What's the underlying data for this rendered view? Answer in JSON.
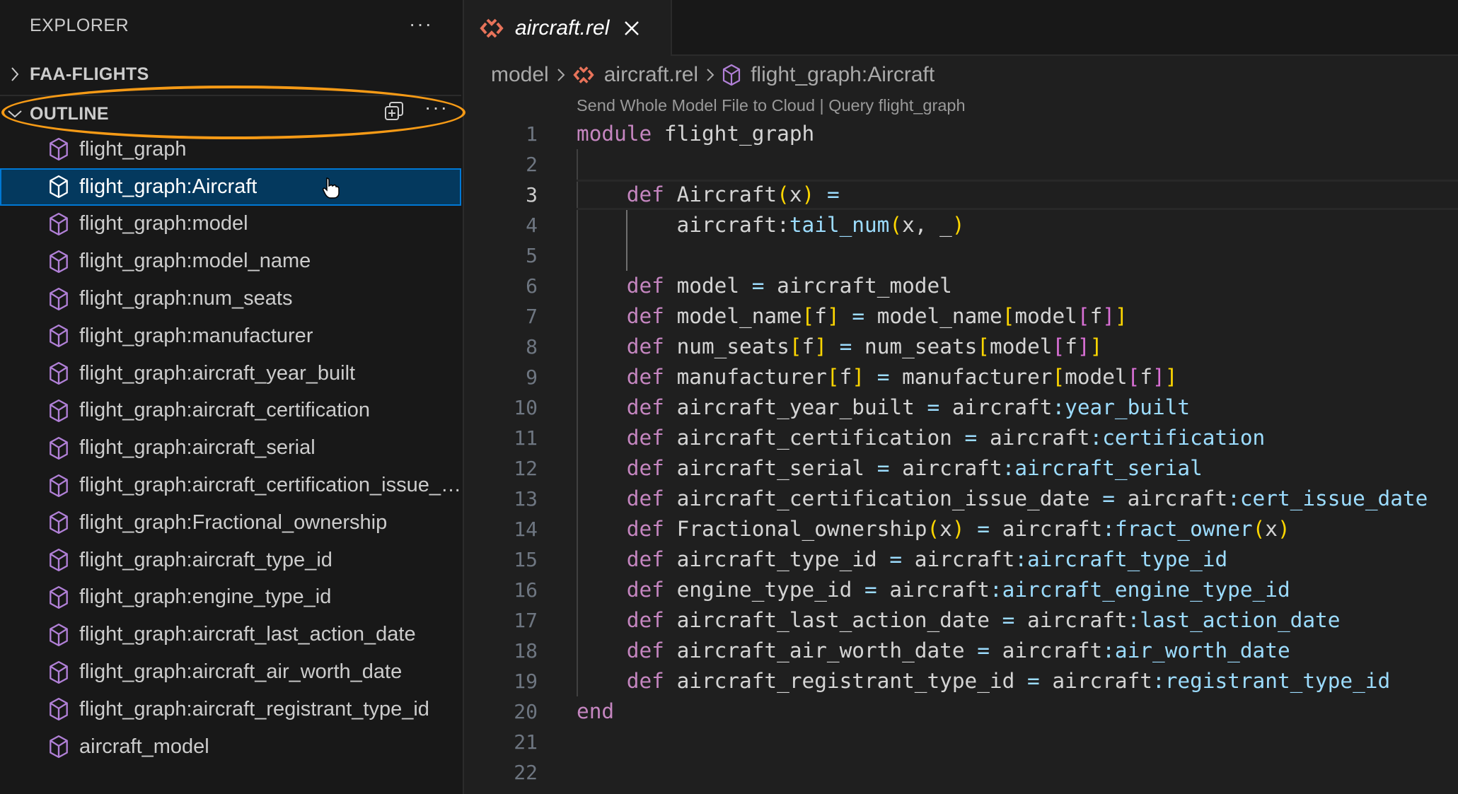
{
  "sidebar": {
    "title": "EXPLORER",
    "more_label": "···",
    "sections": {
      "folder": {
        "label": "FAA-FLIGHTS",
        "expanded": false
      },
      "outline": {
        "label": "OUTLINE",
        "expanded": true,
        "more_label": "···"
      }
    },
    "outline_items": [
      {
        "label": "flight_graph",
        "icon": "module-cube-icon",
        "selected": false
      },
      {
        "label": "flight_graph:Aircraft",
        "icon": "module-cube-icon",
        "selected": true
      },
      {
        "label": "flight_graph:model",
        "icon": "module-cube-icon",
        "selected": false
      },
      {
        "label": "flight_graph:model_name",
        "icon": "module-cube-icon",
        "selected": false
      },
      {
        "label": "flight_graph:num_seats",
        "icon": "module-cube-icon",
        "selected": false
      },
      {
        "label": "flight_graph:manufacturer",
        "icon": "module-cube-icon",
        "selected": false
      },
      {
        "label": "flight_graph:aircraft_year_built",
        "icon": "module-cube-icon",
        "selected": false
      },
      {
        "label": "flight_graph:aircraft_certification",
        "icon": "module-cube-icon",
        "selected": false
      },
      {
        "label": "flight_graph:aircraft_serial",
        "icon": "module-cube-icon",
        "selected": false
      },
      {
        "label": "flight_graph:aircraft_certification_issue_date",
        "icon": "module-cube-icon",
        "selected": false
      },
      {
        "label": "flight_graph:Fractional_ownership",
        "icon": "module-cube-icon",
        "selected": false
      },
      {
        "label": "flight_graph:aircraft_type_id",
        "icon": "module-cube-icon",
        "selected": false
      },
      {
        "label": "flight_graph:engine_type_id",
        "icon": "module-cube-icon",
        "selected": false
      },
      {
        "label": "flight_graph:aircraft_last_action_date",
        "icon": "module-cube-icon",
        "selected": false
      },
      {
        "label": "flight_graph:aircraft_air_worth_date",
        "icon": "module-cube-icon",
        "selected": false
      },
      {
        "label": "flight_graph:aircraft_registrant_type_id",
        "icon": "module-cube-icon",
        "selected": false
      },
      {
        "label": "aircraft_model",
        "icon": "module-cube-icon",
        "selected": false
      }
    ]
  },
  "editor": {
    "tab": {
      "label": "aircraft.rel",
      "icon": "rel-file-icon",
      "italic_preview": true
    },
    "breadcrumb": [
      {
        "label": "model",
        "icon": null
      },
      {
        "label": "aircraft.rel",
        "icon": "rel-file-icon"
      },
      {
        "label": "flight_graph:Aircraft",
        "icon": "module-cube-icon"
      }
    ],
    "codelens": {
      "send": "Send Whole Model File to Cloud",
      "separator": " | ",
      "query": "Query flight_graph"
    },
    "active_line": 3,
    "lines": [
      [
        [
          "kw",
          "module"
        ],
        [
          "id",
          " flight_graph"
        ]
      ],
      [],
      [
        [
          "id",
          "    "
        ],
        [
          "kw",
          "def"
        ],
        [
          "id",
          " Aircraft"
        ],
        [
          "p1",
          "("
        ],
        [
          "id",
          "x"
        ],
        [
          "p1",
          ")"
        ],
        [
          "id",
          " "
        ],
        [
          "op",
          "="
        ]
      ],
      [
        [
          "id",
          "        aircraft:"
        ],
        [
          "rel",
          "tail_num"
        ],
        [
          "p1",
          "("
        ],
        [
          "id",
          "x, _"
        ],
        [
          "p1",
          ")"
        ]
      ],
      [],
      [
        [
          "id",
          "    "
        ],
        [
          "kw",
          "def"
        ],
        [
          "id",
          " model "
        ],
        [
          "op",
          "="
        ],
        [
          "id",
          " aircraft_model"
        ]
      ],
      [
        [
          "id",
          "    "
        ],
        [
          "kw",
          "def"
        ],
        [
          "id",
          " model_name"
        ],
        [
          "p1",
          "["
        ],
        [
          "id",
          "f"
        ],
        [
          "p1",
          "]"
        ],
        [
          "id",
          " "
        ],
        [
          "op",
          "="
        ],
        [
          "id",
          " model_name"
        ],
        [
          "p1",
          "["
        ],
        [
          "id",
          "model"
        ],
        [
          "p2",
          "["
        ],
        [
          "id",
          "f"
        ],
        [
          "p2",
          "]"
        ],
        [
          "p1",
          "]"
        ]
      ],
      [
        [
          "id",
          "    "
        ],
        [
          "kw",
          "def"
        ],
        [
          "id",
          " num_seats"
        ],
        [
          "p1",
          "["
        ],
        [
          "id",
          "f"
        ],
        [
          "p1",
          "]"
        ],
        [
          "id",
          " "
        ],
        [
          "op",
          "="
        ],
        [
          "id",
          " num_seats"
        ],
        [
          "p1",
          "["
        ],
        [
          "id",
          "model"
        ],
        [
          "p2",
          "["
        ],
        [
          "id",
          "f"
        ],
        [
          "p2",
          "]"
        ],
        [
          "p1",
          "]"
        ]
      ],
      [
        [
          "id",
          "    "
        ],
        [
          "kw",
          "def"
        ],
        [
          "id",
          " manufacturer"
        ],
        [
          "p1",
          "["
        ],
        [
          "id",
          "f"
        ],
        [
          "p1",
          "]"
        ],
        [
          "id",
          " "
        ],
        [
          "op",
          "="
        ],
        [
          "id",
          " manufacturer"
        ],
        [
          "p1",
          "["
        ],
        [
          "id",
          "model"
        ],
        [
          "p2",
          "["
        ],
        [
          "id",
          "f"
        ],
        [
          "p2",
          "]"
        ],
        [
          "p1",
          "]"
        ]
      ],
      [
        [
          "id",
          "    "
        ],
        [
          "kw",
          "def"
        ],
        [
          "id",
          " aircraft_year_built "
        ],
        [
          "op",
          "="
        ],
        [
          "id",
          " aircraft"
        ],
        [
          "rel",
          ":year_built"
        ]
      ],
      [
        [
          "id",
          "    "
        ],
        [
          "kw",
          "def"
        ],
        [
          "id",
          " aircraft_certification "
        ],
        [
          "op",
          "="
        ],
        [
          "id",
          " aircraft"
        ],
        [
          "rel",
          ":certification"
        ]
      ],
      [
        [
          "id",
          "    "
        ],
        [
          "kw",
          "def"
        ],
        [
          "id",
          " aircraft_serial "
        ],
        [
          "op",
          "="
        ],
        [
          "id",
          " aircraft"
        ],
        [
          "rel",
          ":aircraft_serial"
        ]
      ],
      [
        [
          "id",
          "    "
        ],
        [
          "kw",
          "def"
        ],
        [
          "id",
          " aircraft_certification_issue_date "
        ],
        [
          "op",
          "="
        ],
        [
          "id",
          " aircraft"
        ],
        [
          "rel",
          ":cert_issue_date"
        ]
      ],
      [
        [
          "id",
          "    "
        ],
        [
          "kw",
          "def"
        ],
        [
          "id",
          " Fractional_ownership"
        ],
        [
          "p1",
          "("
        ],
        [
          "id",
          "x"
        ],
        [
          "p1",
          ")"
        ],
        [
          "id",
          " "
        ],
        [
          "op",
          "="
        ],
        [
          "id",
          " aircraft"
        ],
        [
          "rel",
          ":fract_owner"
        ],
        [
          "p1",
          "("
        ],
        [
          "id",
          "x"
        ],
        [
          "p1",
          ")"
        ]
      ],
      [
        [
          "id",
          "    "
        ],
        [
          "kw",
          "def"
        ],
        [
          "id",
          " aircraft_type_id "
        ],
        [
          "op",
          "="
        ],
        [
          "id",
          " aircraft"
        ],
        [
          "rel",
          ":aircraft_type_id"
        ]
      ],
      [
        [
          "id",
          "    "
        ],
        [
          "kw",
          "def"
        ],
        [
          "id",
          " engine_type_id "
        ],
        [
          "op",
          "="
        ],
        [
          "id",
          " aircraft"
        ],
        [
          "rel",
          ":aircraft_engine_type_id"
        ]
      ],
      [
        [
          "id",
          "    "
        ],
        [
          "kw",
          "def"
        ],
        [
          "id",
          " aircraft_last_action_date "
        ],
        [
          "op",
          "="
        ],
        [
          "id",
          " aircraft"
        ],
        [
          "rel",
          ":last_action_date"
        ]
      ],
      [
        [
          "id",
          "    "
        ],
        [
          "kw",
          "def"
        ],
        [
          "id",
          " aircraft_air_worth_date "
        ],
        [
          "op",
          "="
        ],
        [
          "id",
          " aircraft"
        ],
        [
          "rel",
          ":air_worth_date"
        ]
      ],
      [
        [
          "id",
          "    "
        ],
        [
          "kw",
          "def"
        ],
        [
          "id",
          " aircraft_registrant_type_id "
        ],
        [
          "op",
          "="
        ],
        [
          "id",
          " aircraft"
        ],
        [
          "rel",
          ":registrant_type_id"
        ]
      ],
      [
        [
          "kw",
          "end"
        ]
      ],
      [],
      []
    ]
  },
  "colors": {
    "accent_selection": "#04395e",
    "focus_border": "#0078d4",
    "annotation": "#f59a16",
    "keyword": "#c586c0",
    "relation": "#9cdcfe",
    "bracket_1": "#ffd700",
    "bracket_2": "#da70d6",
    "rel_icon": "#e8735a",
    "cube_icon": "#b180d7"
  }
}
